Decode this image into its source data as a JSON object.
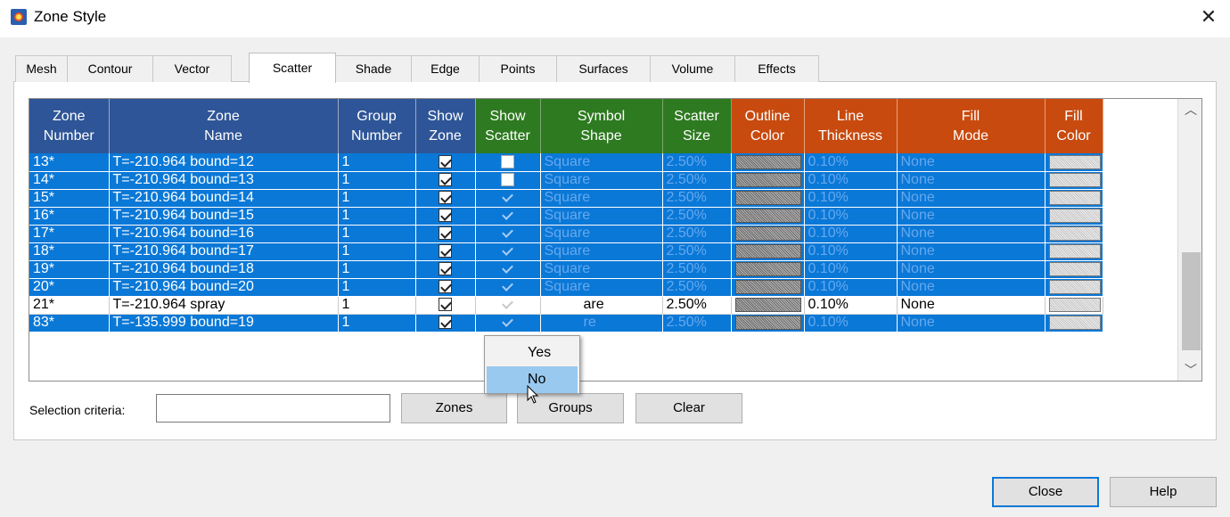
{
  "window": {
    "title": "Zone Style",
    "close_label": "✕"
  },
  "tabs": [
    {
      "label": "Mesh"
    },
    {
      "label": "Contour"
    },
    {
      "label": "Vector"
    },
    {
      "label": "Scatter"
    },
    {
      "label": "Shade"
    },
    {
      "label": "Edge"
    },
    {
      "label": "Points"
    },
    {
      "label": "Surfaces"
    },
    {
      "label": "Volume"
    },
    {
      "label": "Effects"
    }
  ],
  "active_tab": "Scatter",
  "grid": {
    "headers": [
      {
        "line1": "Zone",
        "line2": "Number"
      },
      {
        "line1": "Zone",
        "line2": "Name"
      },
      {
        "line1": "Group",
        "line2": "Number"
      },
      {
        "line1": "Show",
        "line2": "Zone"
      },
      {
        "line1": "Show",
        "line2": "Scatter"
      },
      {
        "line1": "Symbol",
        "line2": "Shape"
      },
      {
        "line1": "Scatter",
        "line2": "Size"
      },
      {
        "line1": "Outline",
        "line2": "Color"
      },
      {
        "line1": "Line",
        "line2": "Thickness"
      },
      {
        "line1": "Fill",
        "line2": "Mode"
      },
      {
        "line1": "Fill",
        "line2": "Color"
      }
    ],
    "header_colors": {
      "zone": "#2e5597",
      "scatter": "#2e7a20",
      "style": "#c84a0e"
    },
    "selection_color": "#0a78d7",
    "rows": [
      {
        "number": "13*",
        "name": "T=-210.964 bound=12",
        "group": "1",
        "shape": "Square",
        "size": "2.50%",
        "thickness": "0.10%",
        "fill_mode": "None"
      },
      {
        "number": "14*",
        "name": "T=-210.964 bound=13",
        "group": "1",
        "shape": "Square",
        "size": "2.50%",
        "thickness": "0.10%",
        "fill_mode": "None"
      },
      {
        "number": "15*",
        "name": "T=-210.964 bound=14",
        "group": "1",
        "shape": "Square",
        "size": "2.50%",
        "thickness": "0.10%",
        "fill_mode": "None"
      },
      {
        "number": "16*",
        "name": "T=-210.964 bound=15",
        "group": "1",
        "shape": "Square",
        "size": "2.50%",
        "thickness": "0.10%",
        "fill_mode": "None"
      },
      {
        "number": "17*",
        "name": "T=-210.964 bound=16",
        "group": "1",
        "shape": "Square",
        "size": "2.50%",
        "thickness": "0.10%",
        "fill_mode": "None"
      },
      {
        "number": "18*",
        "name": "T=-210.964 bound=17",
        "group": "1",
        "shape": "Square",
        "size": "2.50%",
        "thickness": "0.10%",
        "fill_mode": "None"
      },
      {
        "number": "19*",
        "name": "T=-210.964 bound=18",
        "group": "1",
        "shape": "Square",
        "size": "2.50%",
        "thickness": "0.10%",
        "fill_mode": "None"
      },
      {
        "number": "20*",
        "name": "T=-210.964 bound=20",
        "group": "1",
        "shape": "Square",
        "size": "2.50%",
        "thickness": "0.10%",
        "fill_mode": "None"
      },
      {
        "number": "21*",
        "name": "T=-210.964 spray",
        "group": "1",
        "shape": "are",
        "size": "2.50%",
        "thickness": "0.10%",
        "fill_mode": "None"
      },
      {
        "number": "83*",
        "name": "T=-135.999 bound=19",
        "group": "1",
        "shape": "re",
        "size": "2.50%",
        "thickness": "0.10%",
        "fill_mode": "None"
      }
    ]
  },
  "context_menu": {
    "items": [
      "Yes",
      "No"
    ],
    "highlighted": "No"
  },
  "selection_criteria": {
    "label": "Selection criteria:",
    "value": ""
  },
  "buttons": {
    "zones": "Zones",
    "groups": "Groups",
    "clear": "Clear",
    "close": "Close",
    "help": "Help"
  }
}
